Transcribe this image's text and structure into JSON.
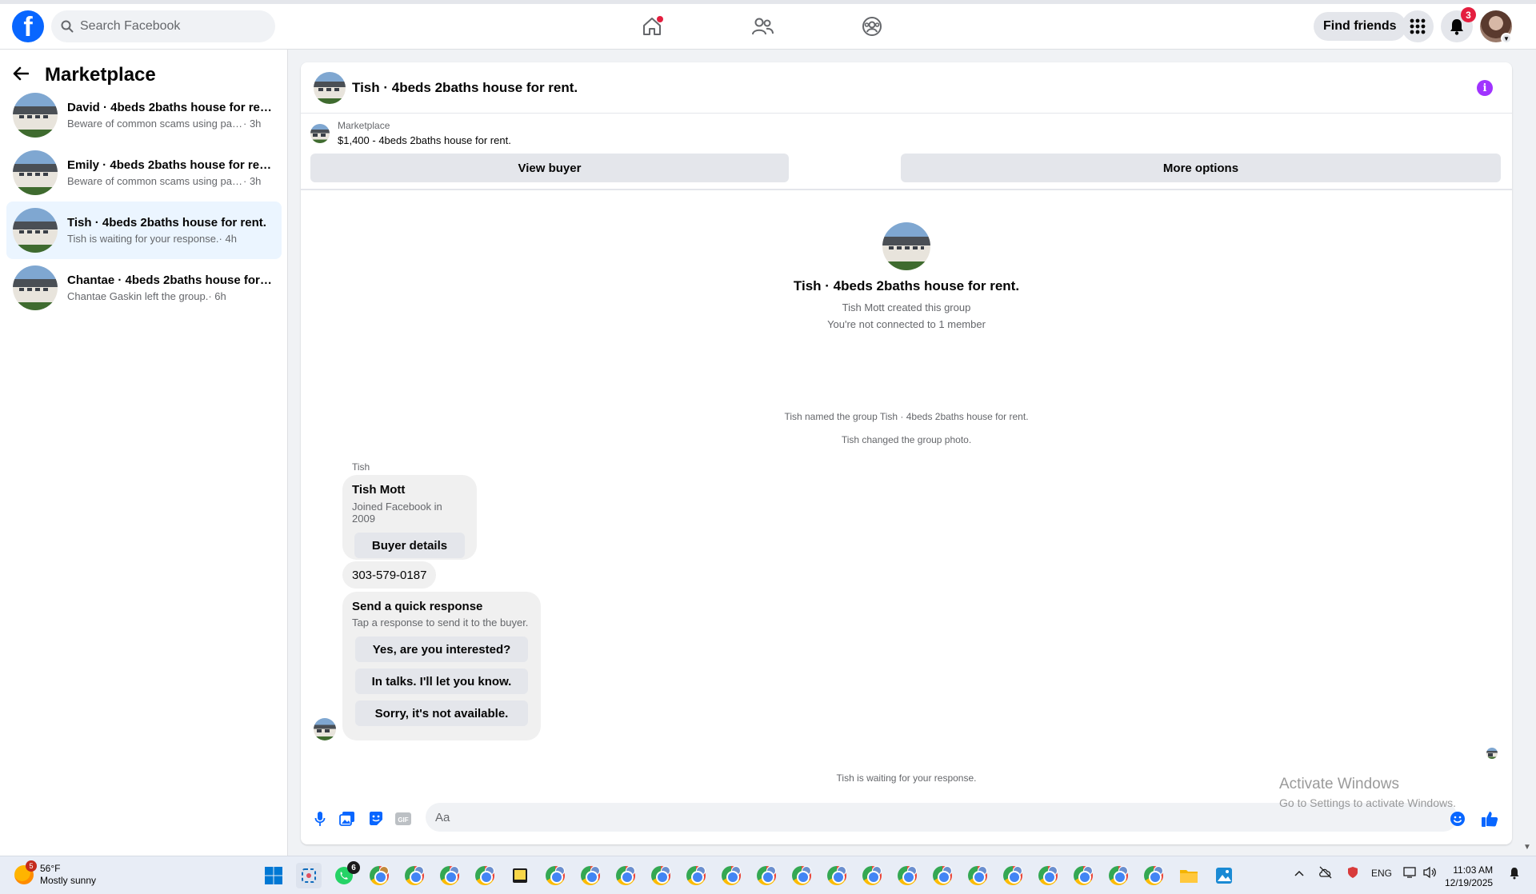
{
  "topbar": {
    "logo": "f",
    "search_placeholder": "Search Facebook",
    "find_friends": "Find friends",
    "notification_count": "3"
  },
  "sidebar": {
    "title": "Marketplace",
    "conversations": [
      {
        "name": "David · 4beds 2baths house for rent.",
        "preview": "Beware of common scams using pay...",
        "time": " · 3h"
      },
      {
        "name": "Emily · 4beds 2baths house for rent.",
        "preview": "Beware of common scams using pay...",
        "time": " · 3h"
      },
      {
        "name": "Tish · 4beds 2baths house for rent.",
        "preview": "Tish is waiting for your response.",
        "time": " · 4h"
      },
      {
        "name": "Chantae · 4beds 2baths house for ...",
        "preview": "Chantae Gaskin left the group.",
        "time": " · 6h"
      }
    ]
  },
  "chat": {
    "title": "Tish · 4beds 2baths house for rent.",
    "listing_source": "Marketplace",
    "listing_price": "$1,400 - 4beds 2baths house for rent.",
    "view_buyer": "View buyer",
    "more_options": "More options",
    "group_name": "Tish · 4beds 2baths house for rent.",
    "group_created": "Tish Mott created this group",
    "group_connection": "You're not connected to 1 member",
    "system_named": "Tish named the group Tish · 4beds 2baths house for rent.",
    "system_photo": "Tish changed the group photo.",
    "sender_label": "Tish",
    "profile_card": {
      "name": "Tish Mott",
      "joined": "Joined Facebook in 2009",
      "button": "Buyer details"
    },
    "phone": "303-579-0187",
    "quick_response": {
      "title": "Send a quick response",
      "subtitle": "Tap a response to send it to the buyer.",
      "options": [
        "Yes, are you interested?",
        "In talks. I'll let you know.",
        "Sorry, it's not available."
      ]
    },
    "waiting": "Tish is waiting for your response.",
    "composer_placeholder": "Aa",
    "gif_label": "GIF"
  },
  "watermark": {
    "title": "Activate Windows",
    "subtitle": "Go to Settings to activate Windows."
  },
  "taskbar": {
    "weather_temp": "56°F",
    "weather_desc": "Mostly sunny",
    "weather_badge": "5",
    "whatsapp_badge": "6",
    "lang": "ENG",
    "time": "11:03 AM",
    "date": "12/19/2025"
  },
  "colors": {
    "facebook_blue": "#0866ff",
    "badge_red": "#e41e3f",
    "active_conversation": "#ebf5ff",
    "info_purple": "#a033ff"
  }
}
